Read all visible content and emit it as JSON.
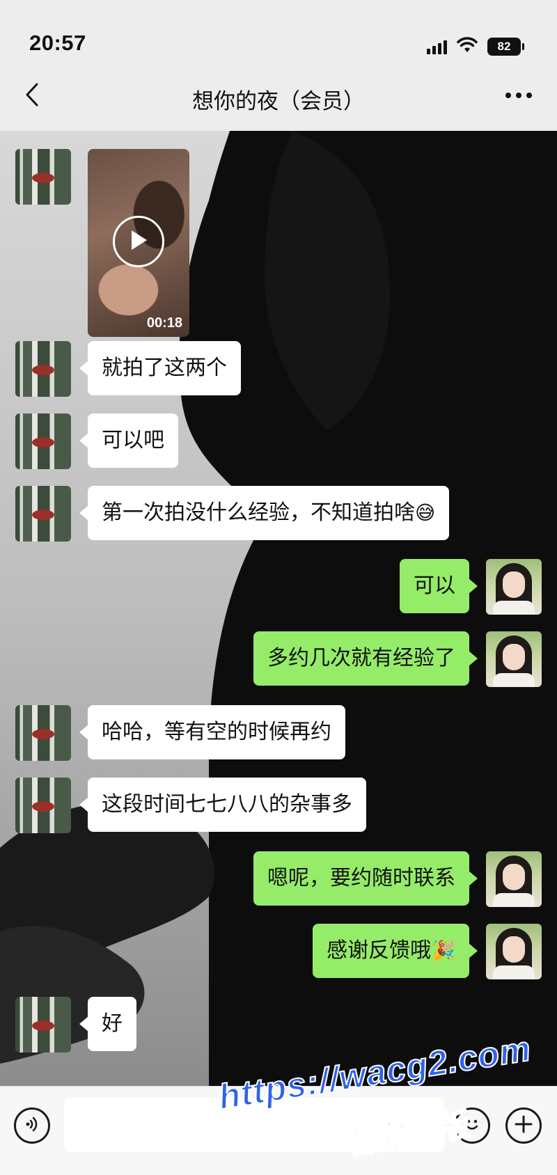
{
  "status_bar": {
    "time": "20:57",
    "battery": "82",
    "icons": [
      "signal-icon",
      "wifi-icon",
      "battery-icon"
    ]
  },
  "header": {
    "title": "想你的夜（会员）",
    "back_icon": "back-chevron-icon",
    "more_icon": "more-icon"
  },
  "video": {
    "duration": "00:18"
  },
  "messages": [
    {
      "side": "left",
      "text": "就拍了这两个"
    },
    {
      "side": "left",
      "text": "可以吧"
    },
    {
      "side": "left",
      "text": "第一次拍没什么经验，不知道拍啥",
      "emoji": "😅"
    },
    {
      "side": "right",
      "text": "可以"
    },
    {
      "side": "right",
      "text": "多约几次就有经验了"
    },
    {
      "side": "left",
      "text": "哈哈，等有空的时候再约"
    },
    {
      "side": "left",
      "text": "这段时间七七八八的杂事多"
    },
    {
      "side": "right",
      "text": "嗯呢，要约随时联系"
    },
    {
      "side": "right",
      "text": "感谢反馈哦",
      "emoji": "🎉"
    },
    {
      "side": "left",
      "text": "好"
    }
  ],
  "input_bar": {
    "placeholder": "",
    "icons": [
      "voice-icon",
      "emoji-icon",
      "plus-icon"
    ]
  },
  "watermark": {
    "url": "https://wacg2.com",
    "text": "看完整版"
  },
  "colors": {
    "background": "#ededed",
    "outgoing_bubble": "#95ec69",
    "incoming_bubble": "#ffffff",
    "watermark": "#2f62e8"
  }
}
